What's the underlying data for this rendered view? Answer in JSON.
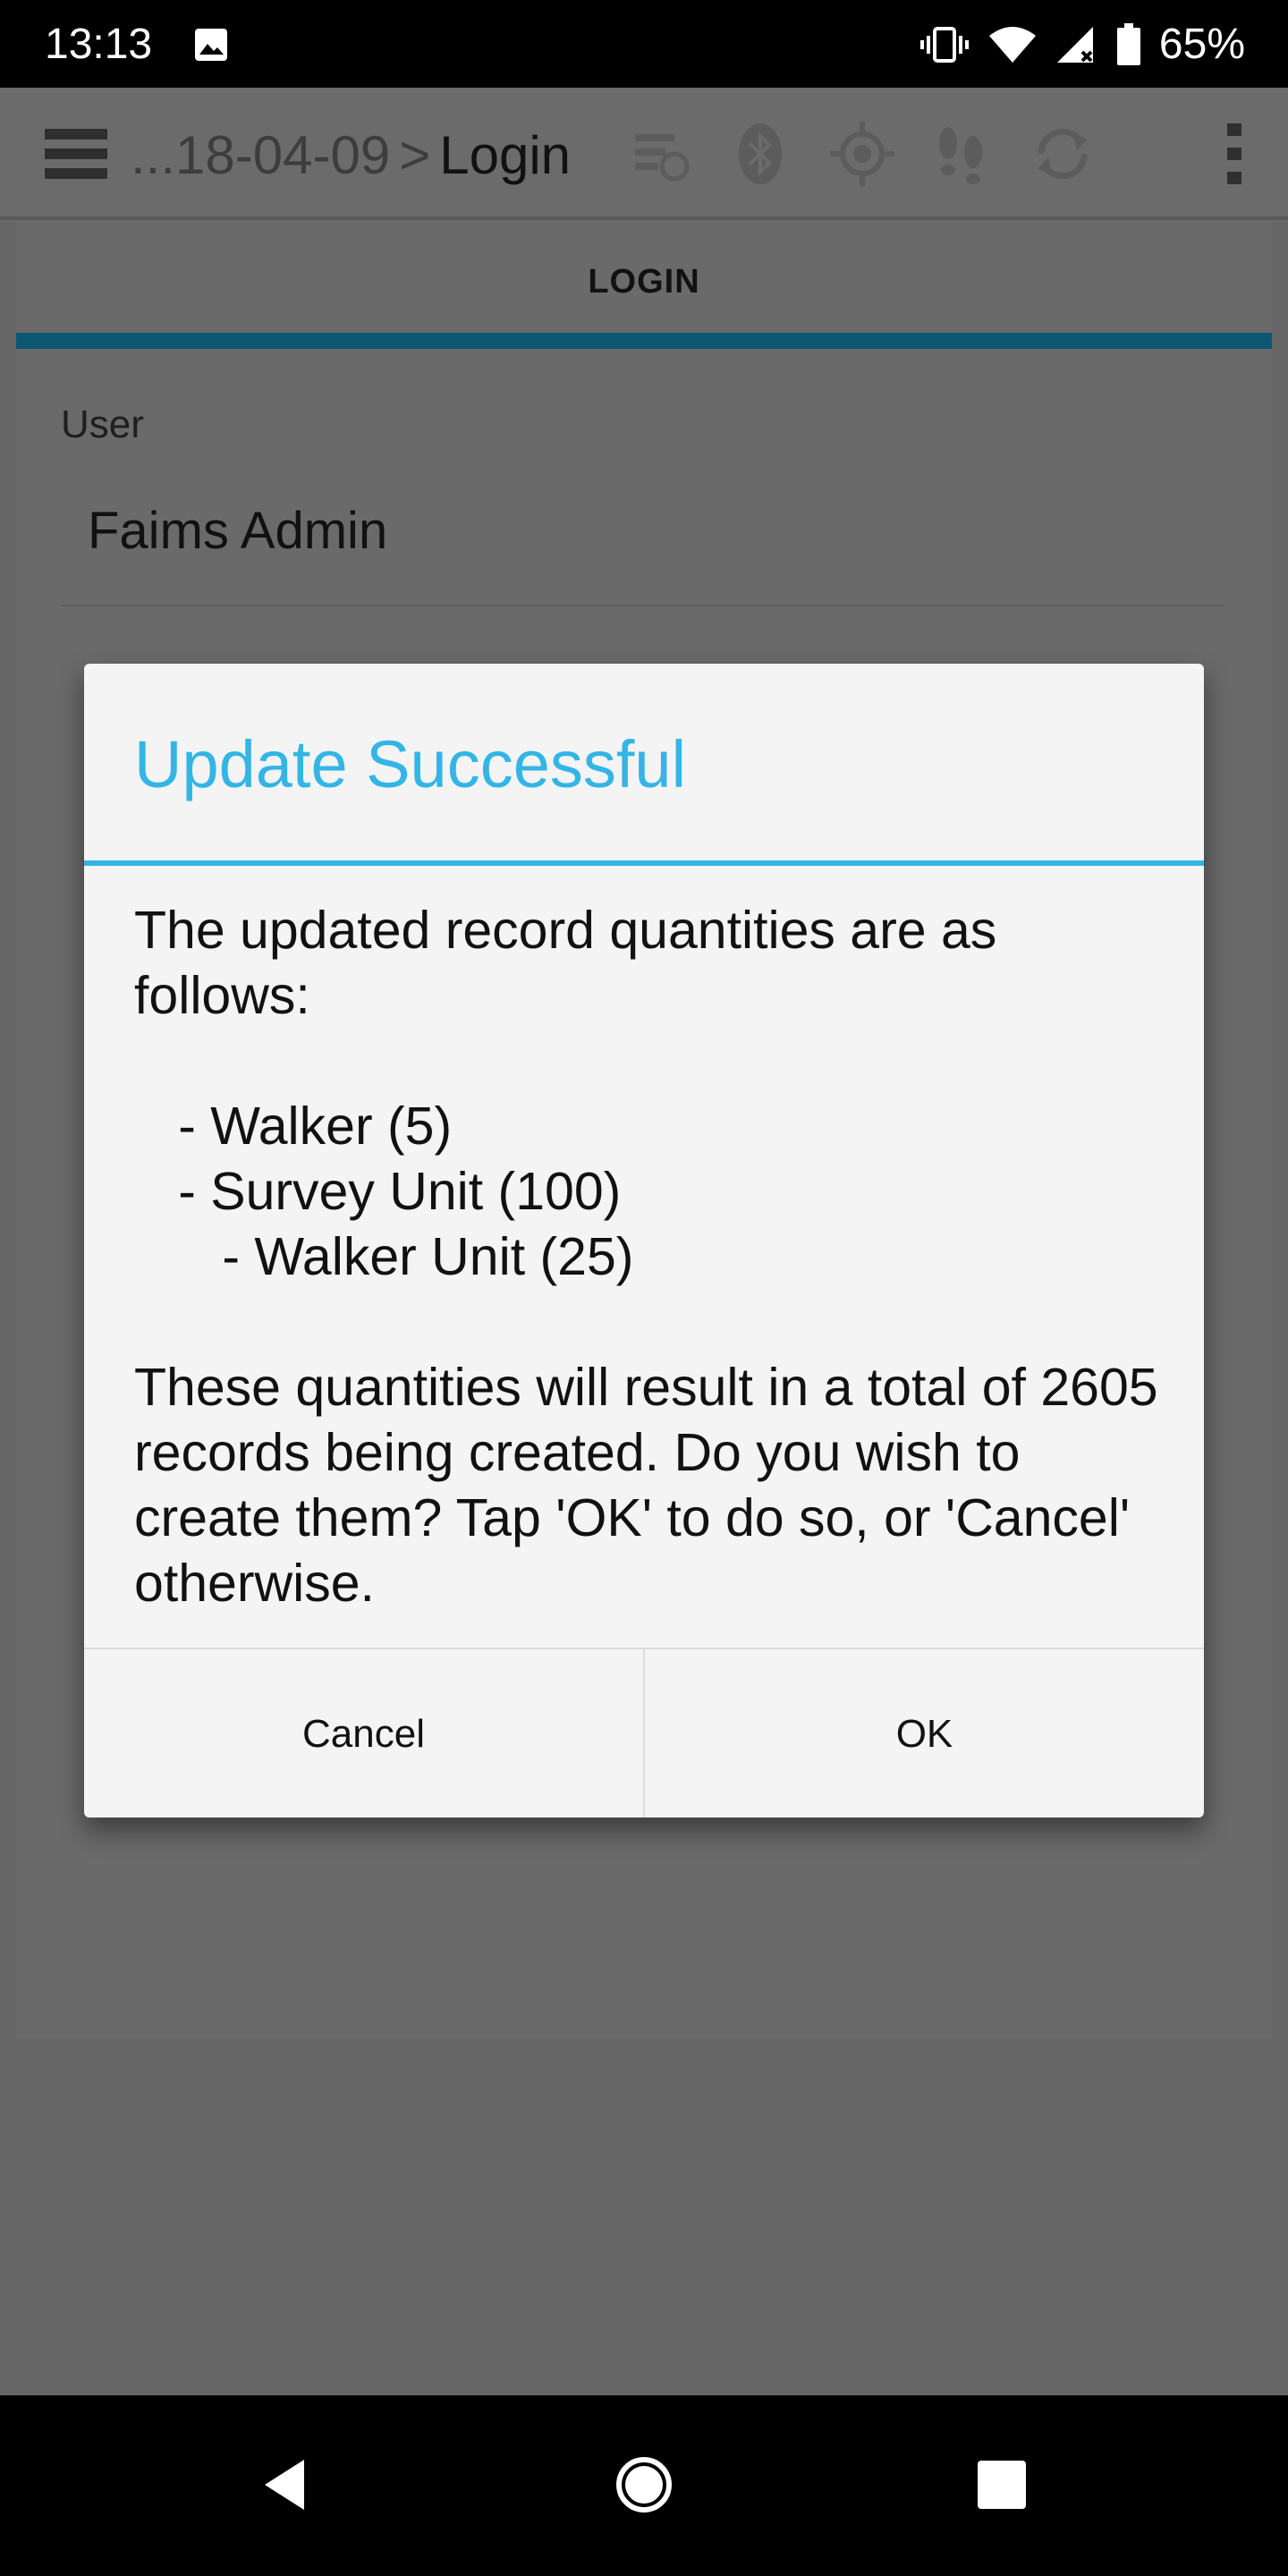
{
  "status_bar": {
    "time": "13:13",
    "battery_percent": "65%",
    "icons": [
      "image-icon",
      "vibrate-icon",
      "wifi-icon",
      "cell-signal-no-data-icon",
      "battery-icon"
    ]
  },
  "toolbar": {
    "breadcrumb_prefix": "...18-04-09",
    "breadcrumb_separator": ">",
    "breadcrumb_current": "Login",
    "icons": [
      "menu-icon",
      "sync-status-icon",
      "bluetooth-icon",
      "gps-icon",
      "tracking-footsteps-icon",
      "sync-icon",
      "overflow-menu-icon"
    ]
  },
  "tabs": {
    "active_label": "LOGIN"
  },
  "form": {
    "user_label": "User",
    "user_value": "Faims Admin"
  },
  "dialog": {
    "title": "Update Successful",
    "message": "The updated record quantities are as follows:\n\n   - Walker (5)\n   - Survey Unit (100)\n      - Walker Unit (25)\n\nThese quantities will result in a total of 2605 records being created. Do you wish to create them? Tap 'OK' to do so, or 'Cancel' otherwise.",
    "cancel_label": "Cancel",
    "ok_label": "OK"
  },
  "colors": {
    "accent": "#33b5e5",
    "tab_indicator": "#0e5773",
    "scrim_background": "#666666",
    "dialog_background": "#f4f4f4"
  },
  "nav_bar": {
    "icons": [
      "back-icon",
      "home-icon",
      "recents-icon"
    ]
  }
}
